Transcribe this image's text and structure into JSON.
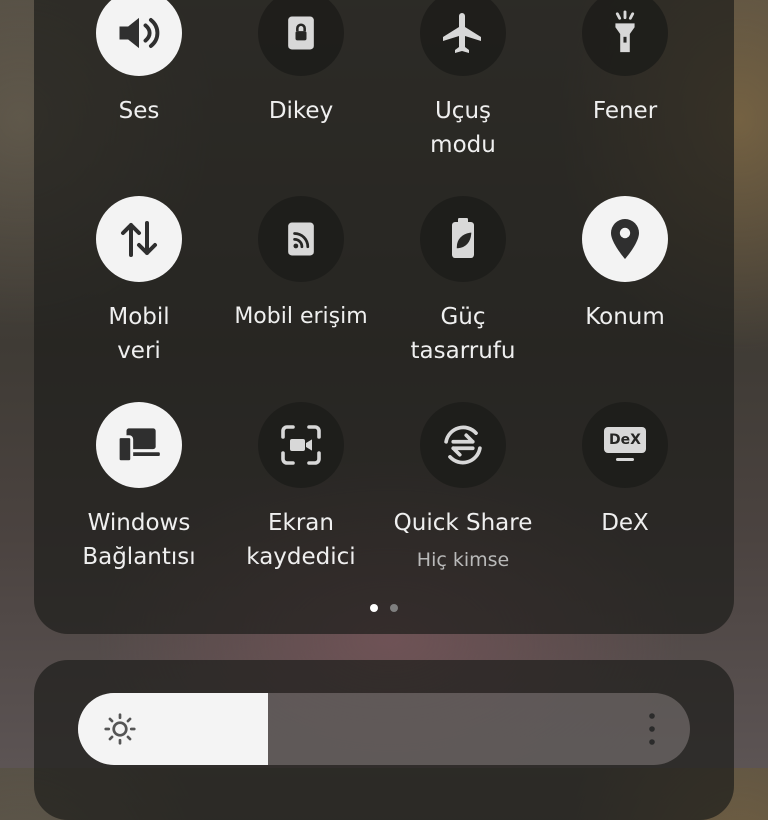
{
  "tiles": [
    {
      "label": "Ses",
      "icon": "volume-icon",
      "on": true
    },
    {
      "label": "Dikey",
      "icon": "portrait-lock-icon",
      "on": false
    },
    {
      "label": "Uçuş\nmodu",
      "icon": "airplane-icon",
      "on": false
    },
    {
      "label": "Fener",
      "icon": "flashlight-icon",
      "on": false
    },
    {
      "label": "Mobil\nveri",
      "icon": "mobile-data-icon",
      "on": true
    },
    {
      "label": "Mobil erişim",
      "icon": "hotspot-icon",
      "on": false
    },
    {
      "label": "Güç\ntasarrufu",
      "icon": "power-saving-icon",
      "on": false
    },
    {
      "label": "Konum",
      "icon": "location-icon",
      "on": true
    },
    {
      "label": "Windows\nBağlantısı",
      "icon": "link-to-windows-icon",
      "on": true
    },
    {
      "label": "Ekran\nkaydedici",
      "icon": "screen-recorder-icon",
      "on": false
    },
    {
      "label": "Quick Share",
      "sublabel": "Hiç kimse",
      "icon": "quick-share-icon",
      "on": false
    },
    {
      "label": "DeX",
      "icon": "dex-icon",
      "dex_text": "DeX",
      "on": false
    }
  ],
  "pager": {
    "pages": 2,
    "current": 1
  },
  "brightness": {
    "level_percent": 31,
    "icon": "sun-icon",
    "menu_icon": "more-options-icon"
  },
  "colors": {
    "tile_on": "#f3f3f3",
    "tile_off": "#1c1c1a",
    "icon_on": "#2f2f2f",
    "icon_off": "#d8d8d8"
  }
}
